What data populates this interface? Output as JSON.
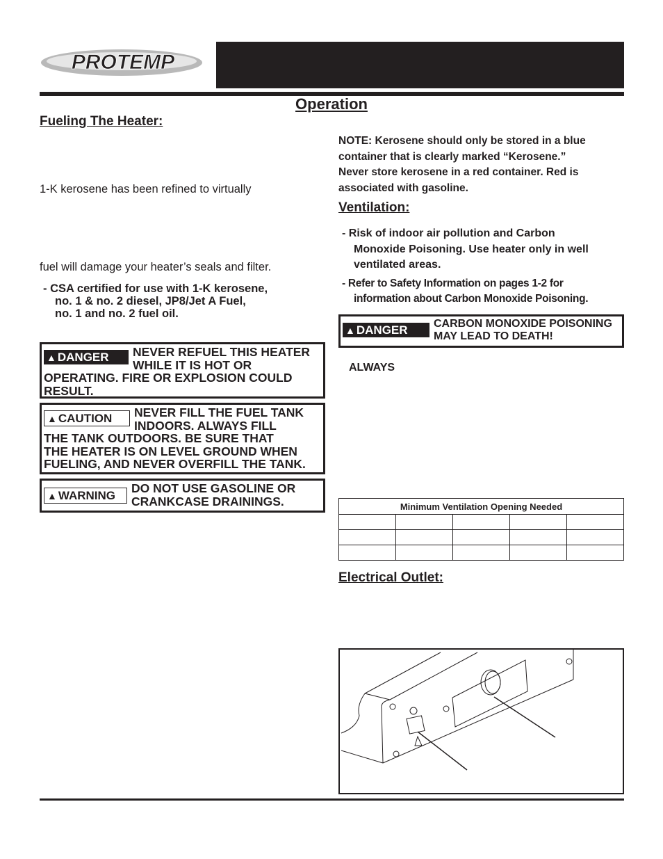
{
  "header": {
    "brand": "PROTEMP",
    "page_title": "Operation"
  },
  "left": {
    "fueling_heading": "Fueling The Heater:",
    "para1": "1-K kerosene has been refined to virtually",
    "para2": "fuel will damage your heater’s seals and filter.",
    "csa_bullet": [
      "- CSA certified for use with 1-K kerosene,",
      "no. 1 & no. 2 diesel, JP8/Jet A Fuel,",
      "no. 1 and no. 2 fuel oil."
    ],
    "danger_box": {
      "signal": "DANGER",
      "line1": "NEVER REFUEL THIS HEATER",
      "line2": "WHILE IT IS HOT OR",
      "line3": "OPERATING. FIRE OR EXPLOSION COULD",
      "line4": "RESULT."
    },
    "caution_box": {
      "signal": "CAUTION",
      "line1": "NEVER FILL THE FUEL TANK",
      "line2": "INDOORS. ALWAYS FILL",
      "line3": "THE TANK OUTDOORS. BE SURE THAT",
      "line4": "THE HEATER IS ON LEVEL GROUND WHEN",
      "line5": "FUELING, AND NEVER OVERFILL THE TANK."
    },
    "warning_box": {
      "signal": "WARNING",
      "line1": "DO NOT USE GASOLINE OR",
      "line2": "CRANKCASE DRAININGS."
    }
  },
  "right": {
    "note": [
      "NOTE: Kerosene should only be stored in a blue",
      "container that is clearly marked “Kerosene.”",
      "Never store kerosene in a red container. Red is",
      "associated with gasoline."
    ],
    "ventilation_heading": "Ventilation:",
    "bullet1": [
      "- Risk of indoor air pollution and Carbon",
      "Monoxide Poisoning. Use heater only in well",
      "ventilated areas."
    ],
    "bullet2": [
      "- Refer to Safety Information on pages 1-2 for",
      "information about Carbon Monoxide Poisoning."
    ],
    "danger_box": {
      "signal": "DANGER",
      "line1": "CARBON MONOXIDE POISONING",
      "line2": "MAY LEAD TO DEATH!"
    },
    "always": "ALWAYS",
    "table_title": "Minimum Ventilation Opening Needed",
    "table_rows": 3,
    "table_cols": 5,
    "electrical_heading": "Electrical Outlet:"
  }
}
